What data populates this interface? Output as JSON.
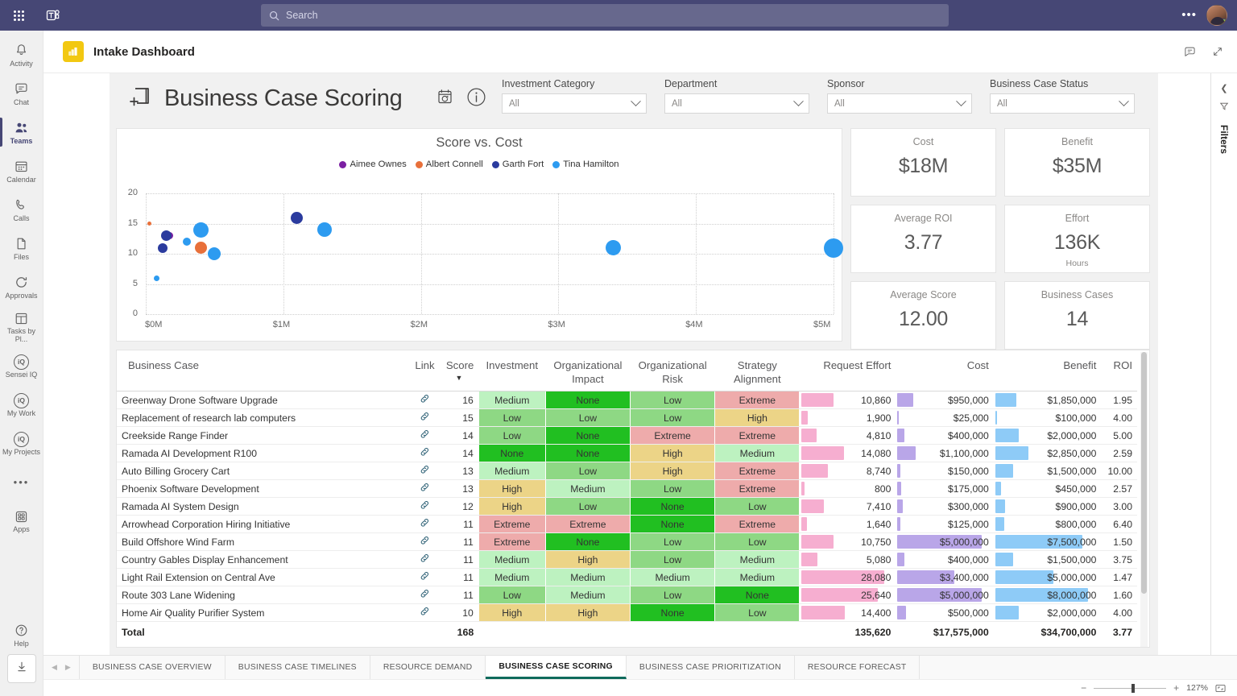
{
  "teams": {
    "search": {
      "placeholder": "Search",
      "icon": "search-icon"
    },
    "app_launcher_icon": "waffle-icon",
    "logo_icon": "teams-logo-icon",
    "more_label": "•••",
    "rail": [
      {
        "label": "Activity",
        "icon": "bell-icon",
        "active": false
      },
      {
        "label": "Chat",
        "icon": "chat-icon",
        "active": false
      },
      {
        "label": "Teams",
        "icon": "teams-people-icon",
        "active": true
      },
      {
        "label": "Calendar",
        "icon": "calendar-icon",
        "active": false
      },
      {
        "label": "Calls",
        "icon": "phone-icon",
        "active": false
      },
      {
        "label": "Files",
        "icon": "file-icon",
        "active": false
      },
      {
        "label": "Approvals",
        "icon": "approvals-icon",
        "active": false
      },
      {
        "label": "Tasks by Pl...",
        "icon": "tasks-planner-icon",
        "active": false
      },
      {
        "label": "Sensei IQ",
        "icon": "iq-icon",
        "active": false
      },
      {
        "label": "My Work",
        "icon": "iq-icon",
        "active": false
      },
      {
        "label": "My Projects",
        "icon": "iq-icon",
        "active": false
      },
      {
        "label": "Apps",
        "icon": "apps-grid-icon",
        "active": false
      },
      {
        "label": "Help",
        "icon": "help-icon",
        "active": false
      }
    ],
    "download_icon": "download-icon"
  },
  "app_header": {
    "title": "Intake Dashboard",
    "app_icon": "power-bi-icon",
    "chat_icon": "conversation-icon",
    "expand_icon": "collapse-diagonal-icon"
  },
  "filters_pane": {
    "label": "Filters",
    "expand_icon": "chevron-left-icon",
    "pin_icon": "pin-filter-icon"
  },
  "report": {
    "title": "Business Case Scoring",
    "title_icon": "add-page-icon",
    "refresh_icon": "calendar-refresh-icon",
    "info_icon": "info-icon",
    "slicers": [
      {
        "label": "Investment Category",
        "value": "All"
      },
      {
        "label": "Department",
        "value": "All"
      },
      {
        "label": "Sponsor",
        "value": "All"
      },
      {
        "label": "Business Case Status",
        "value": "All"
      }
    ]
  },
  "chart_data": {
    "type": "scatter",
    "title": "Score vs. Cost",
    "xlabel": "",
    "ylabel": "",
    "xlim": [
      0,
      5000000
    ],
    "ylim": [
      0,
      20
    ],
    "x_ticks": [
      "$0M",
      "$1M",
      "$2M",
      "$3M",
      "$4M",
      "$5M"
    ],
    "x_tick_values": [
      0,
      1000000,
      2000000,
      3000000,
      4000000,
      5000000
    ],
    "y_ticks": [
      "0",
      "5",
      "10",
      "15",
      "20"
    ],
    "y_tick_values": [
      0,
      5,
      10,
      15,
      20
    ],
    "grid": true,
    "legend_position": "top",
    "legend": [
      {
        "name": "Aimee Ownes",
        "color": "#7b1fa2"
      },
      {
        "name": "Albert Connell",
        "color": "#e8703a"
      },
      {
        "name": "Garth Fort",
        "color": "#2b3b9e"
      },
      {
        "name": "Tina Hamilton",
        "color": "#2d9bf0"
      }
    ],
    "series": [
      {
        "name": "Aimee Ownes",
        "color": "#7b1fa2",
        "points": [
          {
            "x": 175000,
            "y": 13,
            "size": 9
          }
        ]
      },
      {
        "name": "Albert Connell",
        "color": "#e8703a",
        "points": [
          {
            "x": 25000,
            "y": 15,
            "size": 5
          },
          {
            "x": 400000,
            "y": 11,
            "size": 15
          }
        ]
      },
      {
        "name": "Garth Fort",
        "color": "#2b3b9e",
        "points": [
          {
            "x": 150000,
            "y": 13,
            "size": 13
          },
          {
            "x": 125000,
            "y": 11,
            "size": 12
          },
          {
            "x": 1100000,
            "y": 16,
            "size": 15
          }
        ]
      },
      {
        "name": "Tina Hamilton",
        "color": "#2d9bf0",
        "points": [
          {
            "x": 80000,
            "y": 6,
            "size": 7
          },
          {
            "x": 300000,
            "y": 12,
            "size": 10
          },
          {
            "x": 400000,
            "y": 14,
            "size": 19
          },
          {
            "x": 500000,
            "y": 10,
            "size": 16
          },
          {
            "x": 1300000,
            "y": 14,
            "size": 18
          },
          {
            "x": 3400000,
            "y": 11,
            "size": 19
          },
          {
            "x": 5000000,
            "y": 11,
            "size": 24
          }
        ]
      }
    ]
  },
  "kpis": [
    {
      "label": "Cost",
      "value": "$18M",
      "sub": ""
    },
    {
      "label": "Benefit",
      "value": "$35M",
      "sub": ""
    },
    {
      "label": "Average ROI",
      "value": "3.77",
      "sub": ""
    },
    {
      "label": "Effort",
      "value": "136K",
      "sub": "Hours"
    },
    {
      "label": "Average Score",
      "value": "12.00",
      "sub": ""
    },
    {
      "label": "Business Cases",
      "value": "14",
      "sub": ""
    }
  ],
  "table": {
    "columns": [
      "Business Case",
      "Link",
      "Score",
      "Investment",
      "Organizational Impact",
      "Organizational Risk",
      "Strategy Alignment",
      "Request Effort",
      "Cost",
      "Benefit",
      "ROI"
    ],
    "sort_column": "Score",
    "sort_caret": "▼",
    "link_icon": "link-chain-icon",
    "rows": [
      {
        "name": "Greenway Drone Software Upgrade",
        "score": "16",
        "investment": "Medium",
        "org_impact": "None",
        "org_risk": "Low",
        "strategy": "Extreme",
        "effort": "10,860",
        "effort_pct": 39,
        "cost": "$950,000",
        "cost_pct": 19,
        "benefit": "$1,850,000",
        "benefit_pct": 23,
        "roi": "1.95"
      },
      {
        "name": "Replacement of research lab computers",
        "score": "15",
        "investment": "Low",
        "org_impact": "Low",
        "org_risk": "Low",
        "strategy": "High",
        "effort": "1,900",
        "effort_pct": 7,
        "cost": "$25,000",
        "cost_pct": 1,
        "benefit": "$100,000",
        "benefit_pct": 2,
        "roi": "4.00"
      },
      {
        "name": "Creekside Range Finder",
        "score": "14",
        "investment": "Low",
        "org_impact": "None",
        "org_risk": "Extreme",
        "strategy": "Extreme",
        "effort": "4,810",
        "effort_pct": 18,
        "cost": "$400,000",
        "cost_pct": 8,
        "benefit": "$2,000,000",
        "benefit_pct": 25,
        "roi": "5.00"
      },
      {
        "name": "Ramada AI Development R100",
        "score": "14",
        "investment": "None",
        "org_impact": "None",
        "org_risk": "High",
        "strategy": "Medium",
        "effort": "14,080",
        "effort_pct": 51,
        "cost": "$1,100,000",
        "cost_pct": 22,
        "benefit": "$2,850,000",
        "benefit_pct": 36,
        "roi": "2.59"
      },
      {
        "name": "Auto Billing Grocery Cart",
        "score": "13",
        "investment": "Medium",
        "org_impact": "Low",
        "org_risk": "High",
        "strategy": "Extreme",
        "effort": "8,740",
        "effort_pct": 32,
        "cost": "$150,000",
        "cost_pct": 3,
        "benefit": "$1,500,000",
        "benefit_pct": 19,
        "roi": "10.00"
      },
      {
        "name": "Phoenix Software Development",
        "score": "13",
        "investment": "High",
        "org_impact": "Medium",
        "org_risk": "Low",
        "strategy": "Extreme",
        "effort": "800",
        "effort_pct": 3,
        "cost": "$175,000",
        "cost_pct": 4,
        "benefit": "$450,000",
        "benefit_pct": 6,
        "roi": "2.57"
      },
      {
        "name": "Ramada AI System Design",
        "score": "12",
        "investment": "High",
        "org_impact": "Low",
        "org_risk": "None",
        "strategy": "Low",
        "effort": "7,410",
        "effort_pct": 27,
        "cost": "$300,000",
        "cost_pct": 6,
        "benefit": "$900,000",
        "benefit_pct": 11,
        "roi": "3.00"
      },
      {
        "name": "Arrowhead Corporation Hiring Initiative",
        "score": "11",
        "investment": "Extreme",
        "org_impact": "Extreme",
        "org_risk": "None",
        "strategy": "Extreme",
        "effort": "1,640",
        "effort_pct": 6,
        "cost": "$125,000",
        "cost_pct": 3,
        "benefit": "$800,000",
        "benefit_pct": 10,
        "roi": "6.40"
      },
      {
        "name": "Build Offshore Wind Farm",
        "score": "11",
        "investment": "Extreme",
        "org_impact": "None",
        "org_risk": "Low",
        "strategy": "Low",
        "effort": "10,750",
        "effort_pct": 39,
        "cost": "$5,000,000",
        "cost_pct": 100,
        "benefit": "$7,500,000",
        "benefit_pct": 94,
        "roi": "1.50"
      },
      {
        "name": "Country Gables Display Enhancement",
        "score": "11",
        "investment": "Medium",
        "org_impact": "High",
        "org_risk": "Low",
        "strategy": "Medium",
        "effort": "5,080",
        "effort_pct": 19,
        "cost": "$400,000",
        "cost_pct": 8,
        "benefit": "$1,500,000",
        "benefit_pct": 19,
        "roi": "3.75"
      },
      {
        "name": "Light Rail Extension on Central Ave",
        "score": "11",
        "investment": "Medium",
        "org_impact": "Medium",
        "org_risk": "Medium",
        "strategy": "Medium",
        "effort": "28,080",
        "effort_pct": 100,
        "cost": "$3,400,000",
        "cost_pct": 68,
        "benefit": "$5,000,000",
        "benefit_pct": 63,
        "roi": "1.47"
      },
      {
        "name": "Route 303 Lane Widening",
        "score": "11",
        "investment": "Low",
        "org_impact": "Medium",
        "org_risk": "Low",
        "strategy": "None",
        "effort": "25,640",
        "effort_pct": 92,
        "cost": "$5,000,000",
        "cost_pct": 100,
        "benefit": "$8,000,000",
        "benefit_pct": 100,
        "roi": "1.60"
      },
      {
        "name": "Home Air Quality Purifier System",
        "score": "10",
        "investment": "High",
        "org_impact": "High",
        "org_risk": "None",
        "strategy": "Low",
        "effort": "14,400",
        "effort_pct": 52,
        "cost": "$500,000",
        "cost_pct": 10,
        "benefit": "$2,000,000",
        "benefit_pct": 25,
        "roi": "4.00"
      }
    ],
    "total": {
      "label": "Total",
      "score": "168",
      "effort": "135,620",
      "cost": "$17,575,000",
      "benefit": "$34,700,000",
      "roi": "3.77"
    },
    "category_colors": {
      "None": "#21bf21",
      "Low": "#8ed884",
      "Medium": "#bdf2c0",
      "High": "#ecd487",
      "Extreme": "#eeabab"
    },
    "databar_colors": {
      "effort": "#f6aed0",
      "cost": "#b9a6e8",
      "benefit": "#8ecbf7"
    }
  },
  "page_tabs": {
    "prev_icon": "chevron-left-icon",
    "next_icon": "chevron-right-icon",
    "items": [
      {
        "label": "BUSINESS CASE OVERVIEW",
        "active": false
      },
      {
        "label": "BUSINESS CASE TIMELINES",
        "active": false
      },
      {
        "label": "RESOURCE DEMAND",
        "active": false
      },
      {
        "label": "BUSINESS CASE SCORING",
        "active": true
      },
      {
        "label": "BUSINESS CASE PRIORITIZATION",
        "active": false
      },
      {
        "label": "RESOURCE FORECAST",
        "active": false
      }
    ]
  },
  "status_bar": {
    "minus": "−",
    "plus": "+",
    "zoom": "127%",
    "fit_icon": "fit-to-page-icon"
  }
}
